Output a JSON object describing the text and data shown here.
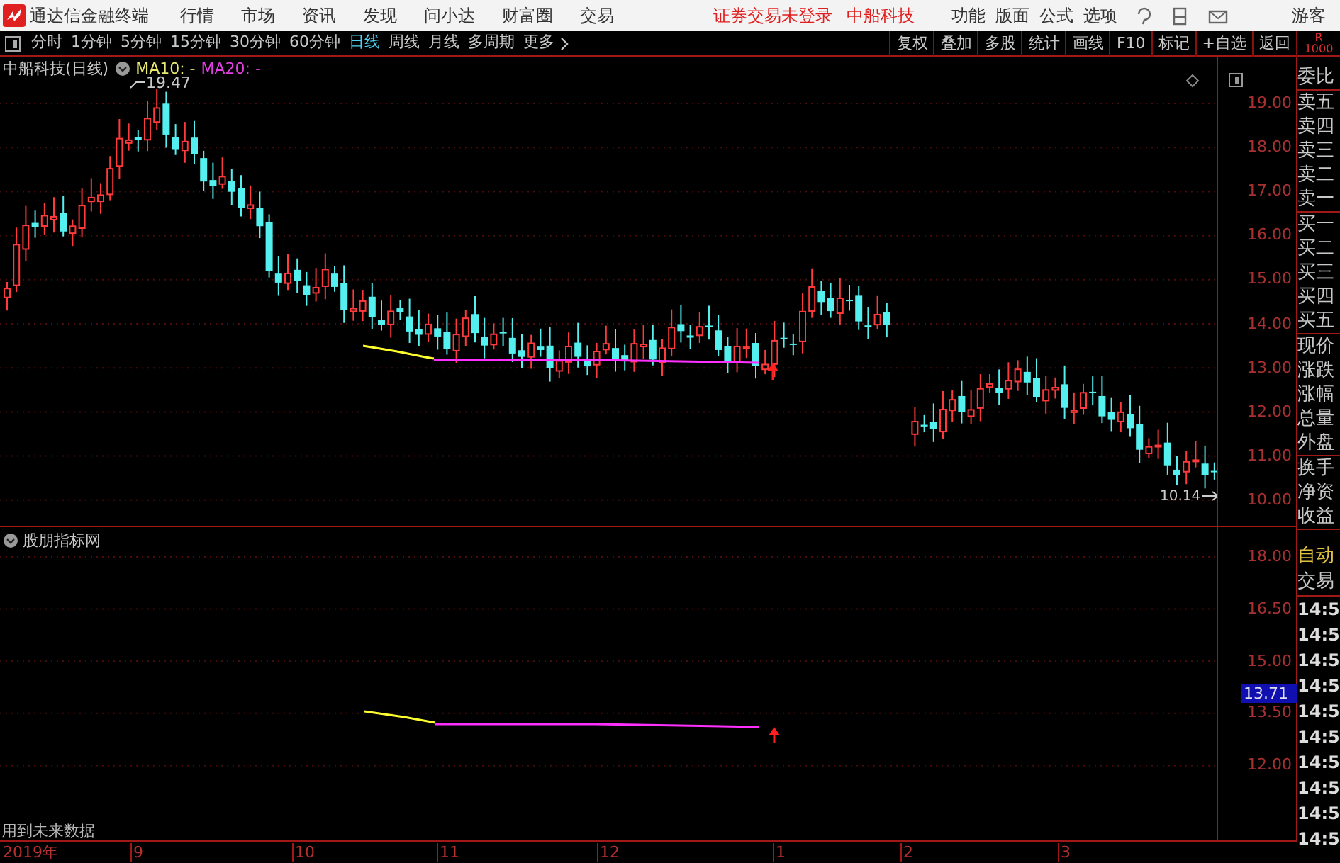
{
  "app_bar": {
    "title": "通达信金融终端",
    "menu": [
      "行情",
      "市场",
      "资讯",
      "发现",
      "问小达",
      "财富圈",
      "交易"
    ],
    "login_status": "证券交易未登录",
    "stock_name": "中船科技",
    "right_menu": [
      "功能",
      "版面",
      "公式",
      "选项"
    ],
    "user": "游客"
  },
  "period_tabs": [
    {
      "label": "分时",
      "selected": false
    },
    {
      "label": "1分钟",
      "selected": false
    },
    {
      "label": "5分钟",
      "selected": false
    },
    {
      "label": "15分钟",
      "selected": false
    },
    {
      "label": "30分钟",
      "selected": false
    },
    {
      "label": "60分钟",
      "selected": false
    },
    {
      "label": "日线",
      "selected": true
    },
    {
      "label": "周线",
      "selected": false
    },
    {
      "label": "月线",
      "selected": false
    },
    {
      "label": "多周期",
      "selected": false
    },
    {
      "label": "更多",
      "selected": false
    }
  ],
  "tools": [
    "复权",
    "叠加",
    "多股",
    "统计",
    "画线",
    "F10",
    "标记",
    "+自选",
    "返回"
  ],
  "main_chart": {
    "title": "中船科技(日线)",
    "ma10": "MA10: -",
    "ma20": "MA20: -",
    "high_label": "19.47",
    "low_label": "10.14",
    "y_ticks": [
      "19.00",
      "18.00",
      "17.00",
      "16.00",
      "15.00",
      "14.00",
      "13.00",
      "12.00",
      "11.00",
      "10.00"
    ]
  },
  "indicator": {
    "title": "股朋指标网",
    "y_ticks": [
      "18.00",
      "16.50",
      "15.00",
      "13.50",
      "12.00"
    ],
    "price_tag": "13.71",
    "note": "用到未来数据"
  },
  "x_axis": [
    "2019年",
    "9",
    "10",
    "11",
    "12",
    "1",
    "2",
    "3"
  ],
  "side_panel": {
    "badge": [
      "R",
      "1000"
    ],
    "groups": [
      [
        "委比"
      ],
      [
        "卖五",
        "卖四",
        "卖三",
        "卖二",
        "卖一"
      ],
      [
        "买一",
        "买二",
        "买三",
        "买四",
        "买五"
      ],
      [
        "现价",
        "涨跌",
        "涨幅",
        "总量",
        "外盘"
      ],
      [
        "换手",
        "净资",
        "收益"
      ]
    ],
    "auto": "自动",
    "trade": "交易",
    "times": [
      "14:5",
      "14:5",
      "14:5",
      "14:5",
      "14:5",
      "14:5",
      "14:5",
      "14:5",
      "14:5",
      "14:5"
    ]
  }
}
